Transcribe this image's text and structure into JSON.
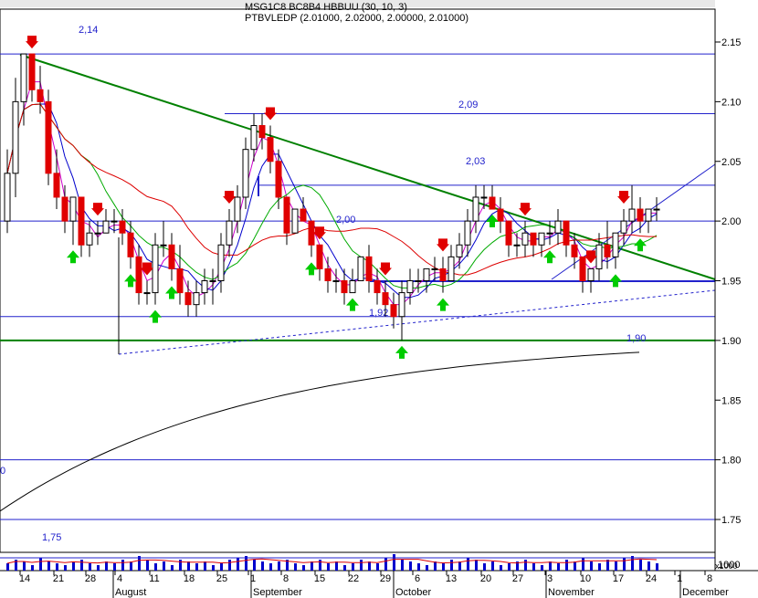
{
  "header": {
    "overlay_text": "MSG1C8 BC8B4 HBBUU (30, 10, 3)",
    "ohlc_label": "PTBVLEDP (2.01000, 2.02000, 2.00000, 2.01000)"
  },
  "volume_axis": {
    "label": "1000",
    "scale": "x1000"
  },
  "chart_data": {
    "type": "candlestick",
    "symbol": "PTBVLEDP",
    "ohlc_last": {
      "open": 2.01,
      "high": 2.02,
      "low": 2.0,
      "close": 2.01
    },
    "y_axis": {
      "ylim": [
        1.715,
        2.19
      ],
      "ticks": [
        "1.75",
        "1.80",
        "1.85",
        "1.90",
        "1.95",
        "2.00",
        "2.05",
        "2.10",
        "2.15"
      ],
      "side": "right"
    },
    "x_axis": {
      "day_ticks": [
        "14",
        "21",
        "28",
        "4",
        "11",
        "18",
        "25",
        "1",
        "8",
        "15",
        "22",
        "29",
        "6",
        "13",
        "20",
        "27",
        "3",
        "10",
        "17",
        "24",
        "1",
        "8"
      ],
      "month_labels": [
        "August",
        "September",
        "October",
        "November",
        "December"
      ]
    },
    "horizontal_levels": [
      {
        "value": 2.14,
        "label": "2,14",
        "color": "#2222cc"
      },
      {
        "value": 2.09,
        "label": "2,09",
        "color": "#2222cc"
      },
      {
        "value": 2.03,
        "label": "2,03",
        "color": "#2222cc"
      },
      {
        "value": 2.0,
        "label": "2,00",
        "color": "#2222cc"
      },
      {
        "value": 1.92,
        "label": "1,92",
        "color": "#2222cc"
      },
      {
        "value": 1.9,
        "label": "1,90",
        "color": "#008000"
      },
      {
        "value": 1.8,
        "label": "0",
        "color": "#2222cc"
      },
      {
        "value": 1.75,
        "label": "1,75",
        "color": "#2222cc"
      }
    ],
    "candles": [
      [
        2.0,
        2.06,
        1.99,
        2.04
      ],
      [
        2.04,
        2.12,
        2.02,
        2.1
      ],
      [
        2.1,
        2.14,
        2.08,
        2.14
      ],
      [
        2.14,
        2.14,
        2.1,
        2.11
      ],
      [
        2.11,
        2.13,
        2.09,
        2.1
      ],
      [
        2.1,
        2.11,
        2.03,
        2.04
      ],
      [
        2.04,
        2.06,
        2.01,
        2.02
      ],
      [
        2.02,
        2.03,
        1.99,
        2.0
      ],
      [
        2.0,
        2.02,
        1.98,
        2.02
      ],
      [
        2.02,
        2.02,
        1.97,
        1.98
      ],
      [
        1.98,
        2.0,
        1.97,
        1.99
      ],
      [
        1.99,
        2.0,
        1.98,
        1.99
      ],
      [
        1.99,
        2.01,
        1.99,
        2.0
      ],
      [
        2.0,
        2.01,
        1.99,
        2.0
      ],
      [
        2.0,
        2.01,
        1.98,
        1.99
      ],
      [
        1.99,
        2.0,
        1.96,
        1.97
      ],
      [
        1.97,
        1.98,
        1.93,
        1.94
      ],
      [
        1.94,
        1.95,
        1.93,
        1.94
      ],
      [
        1.94,
        1.99,
        1.93,
        1.98
      ],
      [
        1.98,
        2.0,
        1.97,
        1.98
      ],
      [
        1.98,
        1.99,
        1.95,
        1.96
      ],
      [
        1.96,
        1.98,
        1.93,
        1.94
      ],
      [
        1.94,
        1.95,
        1.92,
        1.93
      ],
      [
        1.93,
        1.95,
        1.92,
        1.94
      ],
      [
        1.94,
        1.96,
        1.93,
        1.95
      ],
      [
        1.95,
        1.96,
        1.93,
        1.95
      ],
      [
        1.95,
        1.99,
        1.94,
        1.98
      ],
      [
        1.98,
        2.01,
        1.97,
        2.0
      ],
      [
        2.0,
        2.03,
        1.99,
        2.02
      ],
      [
        2.02,
        2.07,
        2.01,
        2.06
      ],
      [
        2.06,
        2.09,
        2.05,
        2.08
      ],
      [
        2.08,
        2.09,
        2.06,
        2.07
      ],
      [
        2.07,
        2.08,
        2.04,
        2.05
      ],
      [
        2.05,
        2.06,
        2.01,
        2.02
      ],
      [
        2.02,
        2.02,
        1.98,
        1.99
      ],
      [
        1.99,
        2.01,
        1.99,
        2.01
      ],
      [
        2.01,
        2.02,
        2.0,
        2.0
      ],
      [
        2.0,
        2.0,
        1.97,
        1.98
      ],
      [
        1.98,
        1.98,
        1.95,
        1.96
      ],
      [
        1.96,
        1.97,
        1.94,
        1.95
      ],
      [
        1.95,
        1.96,
        1.94,
        1.95
      ],
      [
        1.95,
        1.96,
        1.93,
        1.94
      ],
      [
        1.94,
        1.96,
        1.94,
        1.95
      ],
      [
        1.95,
        1.97,
        1.95,
        1.97
      ],
      [
        1.97,
        1.98,
        1.94,
        1.95
      ],
      [
        1.95,
        1.96,
        1.93,
        1.94
      ],
      [
        1.94,
        1.95,
        1.92,
        1.93
      ],
      [
        1.93,
        1.94,
        1.91,
        1.92
      ],
      [
        1.92,
        1.95,
        1.9,
        1.94
      ],
      [
        1.94,
        1.96,
        1.93,
        1.95
      ],
      [
        1.95,
        1.96,
        1.94,
        1.95
      ],
      [
        1.95,
        1.96,
        1.94,
        1.96
      ],
      [
        1.96,
        1.97,
        1.95,
        1.96
      ],
      [
        1.96,
        1.97,
        1.94,
        1.95
      ],
      [
        1.95,
        1.98,
        1.95,
        1.97
      ],
      [
        1.97,
        1.99,
        1.96,
        1.98
      ],
      [
        1.98,
        2.01,
        1.97,
        2.0
      ],
      [
        2.0,
        2.03,
        1.99,
        2.02
      ],
      [
        2.02,
        2.03,
        2.01,
        2.02
      ],
      [
        2.02,
        2.03,
        2.01,
        2.01
      ],
      [
        2.01,
        2.02,
        1.99,
        2.0
      ],
      [
        2.0,
        2.0,
        1.97,
        1.98
      ],
      [
        1.98,
        1.99,
        1.97,
        1.98
      ],
      [
        1.98,
        2.0,
        1.97,
        1.99
      ],
      [
        1.99,
        1.99,
        1.97,
        1.98
      ],
      [
        1.98,
        1.99,
        1.97,
        1.99
      ],
      [
        1.99,
        2.0,
        1.98,
        1.99
      ],
      [
        1.99,
        2.01,
        1.98,
        2.0
      ],
      [
        2.0,
        2.0,
        1.97,
        1.98
      ],
      [
        1.98,
        1.99,
        1.96,
        1.97
      ],
      [
        1.97,
        1.97,
        1.94,
        1.95
      ],
      [
        1.95,
        1.96,
        1.94,
        1.96
      ],
      [
        1.96,
        1.99,
        1.95,
        1.98
      ],
      [
        1.98,
        2.0,
        1.96,
        1.97
      ],
      [
        1.97,
        1.99,
        1.96,
        1.99
      ],
      [
        1.99,
        2.01,
        1.98,
        2.0
      ],
      [
        2.0,
        2.03,
        1.99,
        2.01
      ],
      [
        2.01,
        2.02,
        1.99,
        2.0
      ],
      [
        2.0,
        2.01,
        1.99,
        2.01
      ],
      [
        2.01,
        2.02,
        2.0,
        2.01
      ]
    ],
    "volume": [
      4,
      6,
      5,
      3,
      7,
      5,
      4,
      3,
      5,
      6,
      4,
      3,
      5,
      4,
      6,
      5,
      8,
      6,
      4,
      5,
      3,
      6,
      5,
      4,
      5,
      3,
      4,
      6,
      7,
      8,
      6,
      5,
      4,
      5,
      6,
      4,
      3,
      5,
      6,
      4,
      5,
      3,
      4,
      6,
      5,
      4,
      7,
      9,
      6,
      5,
      4,
      3,
      5,
      4,
      6,
      5,
      7,
      6,
      4,
      5,
      3,
      4,
      5,
      6,
      4,
      3,
      5,
      4,
      6,
      5,
      7,
      5,
      4,
      6,
      5,
      7,
      8,
      6,
      5,
      4
    ]
  }
}
